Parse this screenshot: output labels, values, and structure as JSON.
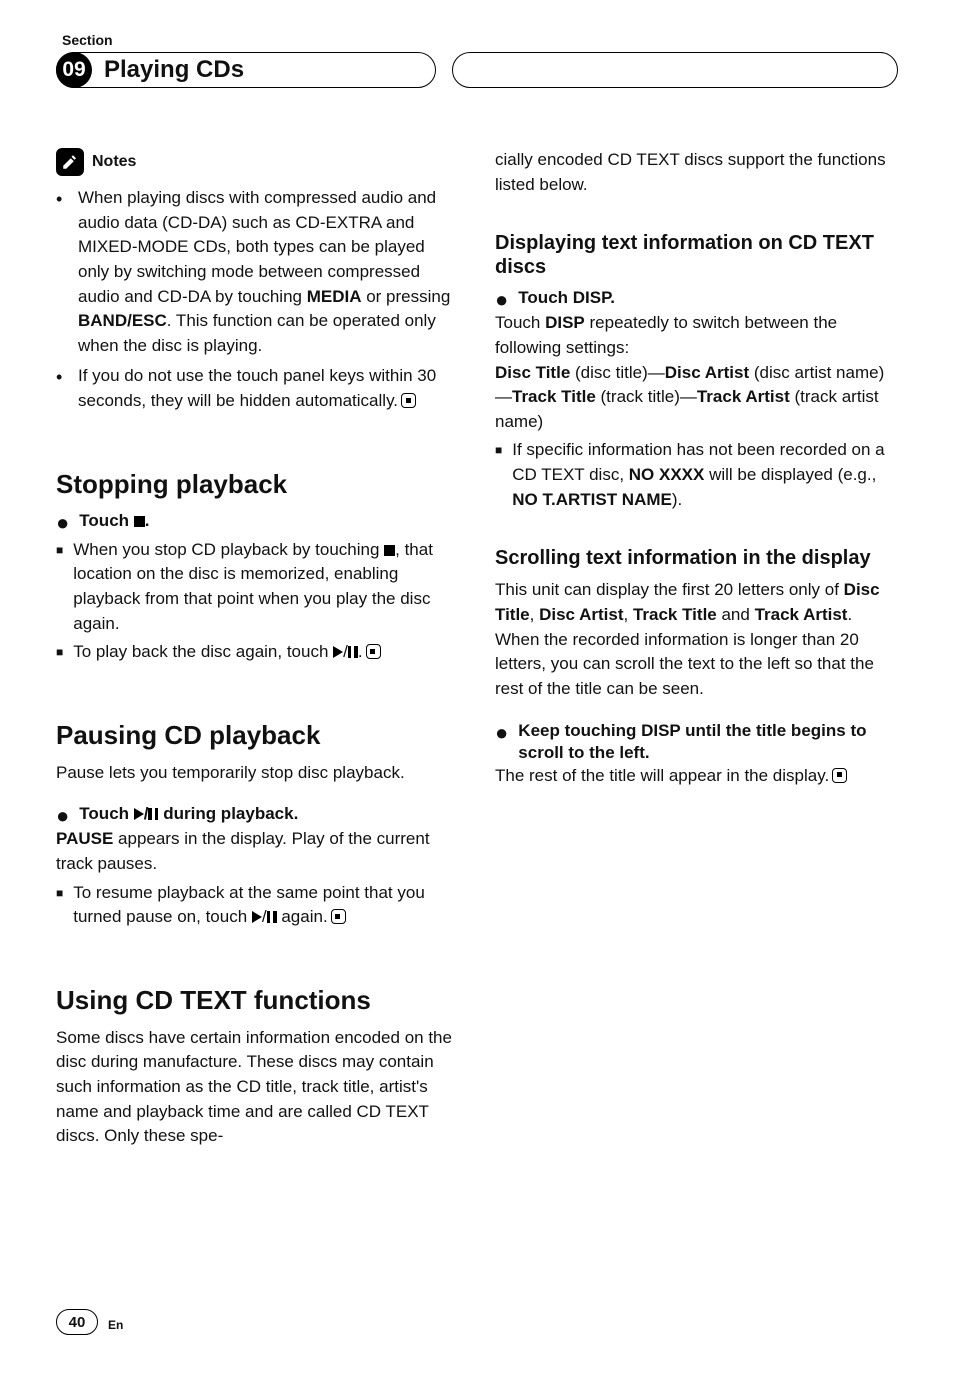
{
  "header": {
    "section_label": "Section",
    "section_number": "09",
    "chapter_title": "Playing CDs"
  },
  "notes": {
    "heading": "Notes",
    "items": [
      {
        "pre": "When playing discs with compressed audio and audio data (CD-DA) such as CD-EXTRA and MIXED-MODE CDs, both types can be played only by switching mode between compressed audio and CD-DA by touching ",
        "bold1": "MEDIA",
        "mid": " or pressing ",
        "bold2": "BAND/ESC",
        "post": ". This function can be operated only when the disc is playing."
      },
      {
        "text": "If you do not use the touch panel keys within 30 seconds, they will be hidden automatically."
      }
    ]
  },
  "stopping": {
    "heading": "Stopping playback",
    "step_pre": "Touch ",
    "step_post": ".",
    "sq1_pre": "When you stop CD playback by touching ",
    "sq1_post": ", that location on the disc is memorized, enabling playback from that point when you play the disc again.",
    "sq2_pre": "To play back the disc again, touch ",
    "sq2_post": "."
  },
  "pausing": {
    "heading": "Pausing CD playback",
    "intro": "Pause lets you temporarily stop disc playback.",
    "step_pre": "Touch ",
    "step_post": " during playback.",
    "body_bold": "PAUSE",
    "body_rest": " appears in the display. Play of the current track pauses.",
    "sq_pre": "To resume playback at the same point that you turned pause on, touch ",
    "sq_post": " again."
  },
  "cdtext": {
    "heading": "Using CD TEXT functions",
    "intro_left": "Some discs have certain information encoded on the disc during manufacture. These discs may contain such information as the CD title, track title, artist's name and playback time and are called CD TEXT discs. Only these spe-",
    "intro_right": "cially encoded CD TEXT discs support the functions listed below.",
    "displaying": {
      "heading": "Displaying text information on CD TEXT discs",
      "step": "Touch DISP.",
      "body_pre": "Touch ",
      "body_bold1": "DISP",
      "body_mid": " repeatedly to switch between the following settings:",
      "line2_b1": "Disc Title",
      "line2_t1": " (disc title)—",
      "line2_b2": "Disc Artist",
      "line2_t2": " (disc artist name)—",
      "line2_b3": "Track Title",
      "line2_t3": " (track title)—",
      "line2_b4": "Track Artist",
      "line2_t4": " (track artist name)",
      "sq_pre": "If specific information has not been recorded on a CD TEXT disc, ",
      "sq_bold1": "NO XXXX",
      "sq_mid": " will be displayed (e.g., ",
      "sq_bold2": "NO T.ARTIST NAME",
      "sq_post": ")."
    },
    "scrolling": {
      "heading": "Scrolling text information in the display",
      "intro_pre": "This unit can display the first 20 letters only of ",
      "b1": "Disc Title",
      "s1": ", ",
      "b2": "Disc Artist",
      "s2": ", ",
      "b3": "Track Title",
      "s3": " and ",
      "b4": "Track Artist",
      "intro_post": ". When the recorded information is longer than 20 letters, you can scroll the text to the left so that the rest of the title can be seen.",
      "step": "Keep touching DISP until the title begins to scroll to the left.",
      "body": "The rest of the title will appear in the display."
    }
  },
  "footer": {
    "page_number": "40",
    "lang": "En"
  }
}
